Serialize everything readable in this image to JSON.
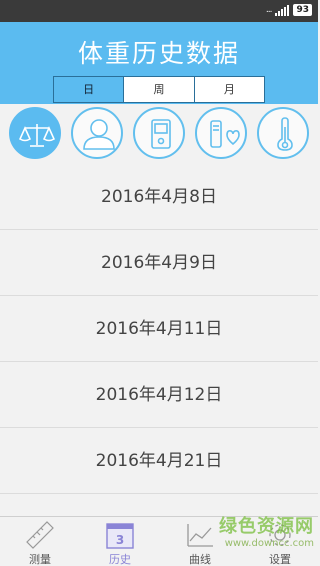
{
  "status_bar": {
    "signal_dots": "...",
    "battery_level": "93"
  },
  "header": {
    "title": "体重历史数据",
    "tabs": [
      {
        "label": "日",
        "active": true
      },
      {
        "label": "周",
        "active": false
      },
      {
        "label": "月",
        "active": false
      }
    ]
  },
  "category_icons": [
    {
      "icon": "scale-icon",
      "active": true
    },
    {
      "icon": "person-icon",
      "active": false
    },
    {
      "icon": "device-icon",
      "active": false
    },
    {
      "icon": "heart-monitor-icon",
      "active": false
    },
    {
      "icon": "thermometer-icon",
      "active": false
    }
  ],
  "dates": [
    "2016年4月8日",
    "2016年4月9日",
    "2016年4月11日",
    "2016年4月12日",
    "2016年4月21日"
  ],
  "tab_bar": {
    "items": [
      {
        "label": "测量",
        "icon": "ruler-icon",
        "active": false
      },
      {
        "label": "历史",
        "icon": "calendar-icon",
        "active": true,
        "badge": "3"
      },
      {
        "label": "曲线",
        "icon": "chart-icon",
        "active": false
      },
      {
        "label": "设置",
        "icon": "gear-icon",
        "active": false
      }
    ]
  },
  "watermark": {
    "title": "绿色资源网",
    "url": "www.downcc.com"
  },
  "colors": {
    "header_blue": "#5bbbf0",
    "active_tab_text": "#8a84d6",
    "status_bar": "#3a3a3a"
  }
}
